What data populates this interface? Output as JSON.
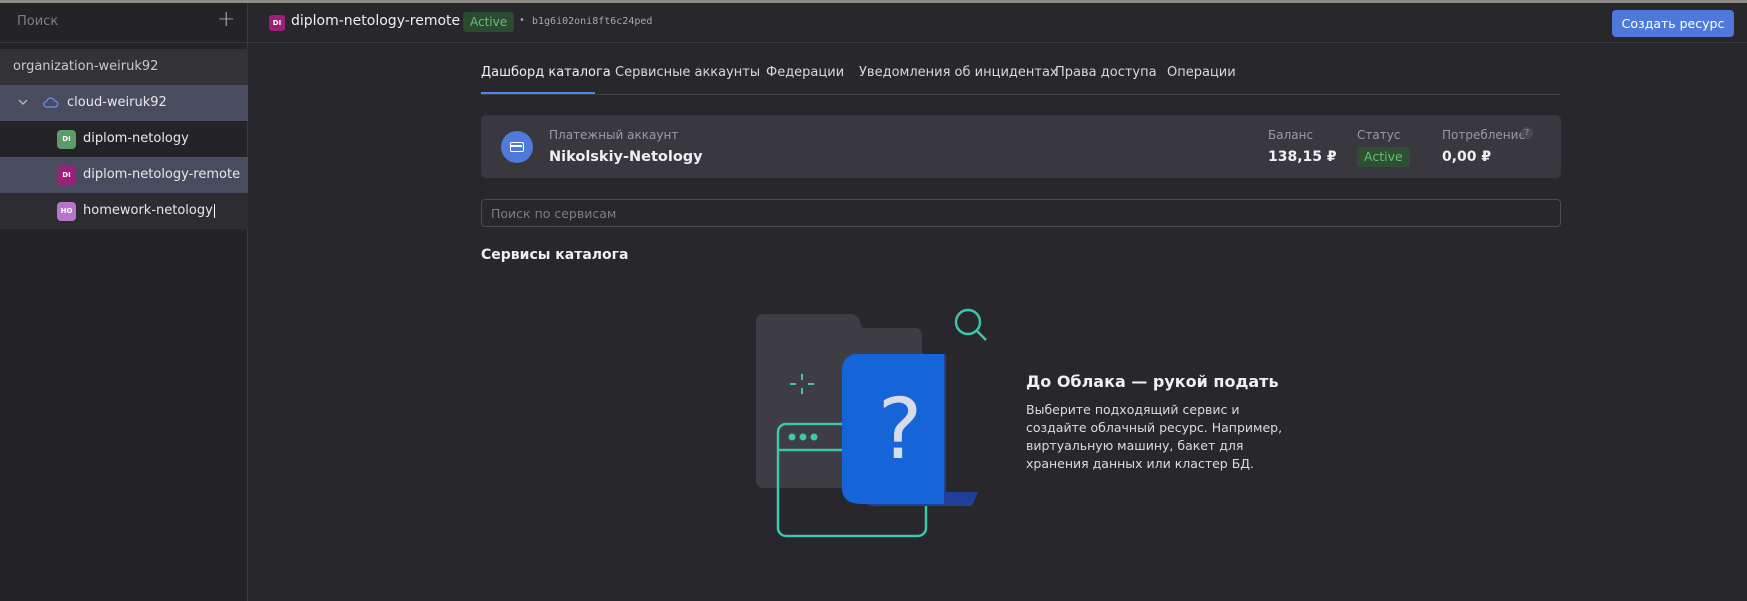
{
  "sidebar": {
    "search_placeholder": "Поиск",
    "add_icon": "plus-icon",
    "organization": "organization-weiruk92",
    "cloud": {
      "label": "cloud-weiruk92",
      "icon": "cloud-icon",
      "expanded": true
    },
    "folders": [
      {
        "badge": "DI",
        "label": "diplom-netology",
        "badge_color": "#5a9c6a",
        "selected": false
      },
      {
        "badge": "DI",
        "label": "diplom-netology-remote",
        "badge_color": "#9c1f7a",
        "selected": true
      },
      {
        "badge": "HO",
        "label": "homework-netology",
        "badge_color": "#b873cf",
        "selected": false
      }
    ]
  },
  "header": {
    "badge": "DI",
    "title": "diplom-netology-remote",
    "status": "Active",
    "separator": "•",
    "folder_id": "b1g6i02oni8ft6c24ped",
    "create_button": "Создать ресурс"
  },
  "tabs": [
    {
      "label": "Дашборд каталога",
      "active": true
    },
    {
      "label": "Сервисные аккаунты",
      "active": false
    },
    {
      "label": "Федерации",
      "active": false
    },
    {
      "label": "Уведомления об инцидентах",
      "active": false
    },
    {
      "label": "Права доступа",
      "active": false
    },
    {
      "label": "Операции",
      "active": false
    }
  ],
  "billing": {
    "icon": "credit-card-icon",
    "label": "Платежный аккаунт",
    "name": "Nikolskiy-Netology",
    "balance_label": "Баланс",
    "balance_value": "138,15 ₽",
    "status_label": "Статус",
    "status_value": "Active",
    "consumption_label": "Потребление",
    "consumption_value": "0,00 ₽",
    "help_icon": "?"
  },
  "services": {
    "search_placeholder": "Поиск по сервисам",
    "title": "Сервисы каталога"
  },
  "empty_state": {
    "title": "До Облака — рукой подать",
    "text": "Выберите подходящий сервис и создайте облачный ресурс. Например, виртуальную машину, бакет для хранения данных или кластер БД."
  },
  "colors": {
    "accent": "#4e79db",
    "status_green": "#62c374",
    "selected_row": "#484c5e"
  }
}
